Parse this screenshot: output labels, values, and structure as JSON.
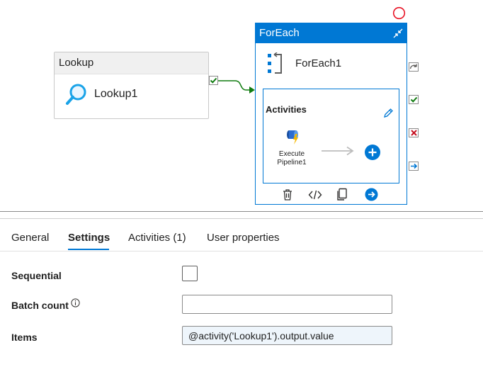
{
  "canvas": {
    "lookup": {
      "header": "Lookup",
      "name": "Lookup1"
    },
    "foreach": {
      "header": "ForEach",
      "name": "ForEach1",
      "activities_label": "Activities",
      "inner_activity": {
        "line1": "Execute",
        "line2": "Pipeline1"
      }
    }
  },
  "tabs": [
    {
      "label": "General"
    },
    {
      "label": "Settings"
    },
    {
      "label": "Activities (1)"
    },
    {
      "label": "User properties"
    }
  ],
  "settings": {
    "sequential_label": "Sequential",
    "sequential_checked": false,
    "batch_count_label": "Batch count",
    "batch_count_value": "",
    "items_label": "Items",
    "items_value": "@activity('Lookup1').output.value"
  },
  "colors": {
    "accent": "#0078d4",
    "success": "#107c10",
    "failure": "#c50f1f",
    "error_indicator": "#e81123"
  },
  "icons": {
    "lookup": "magnifier-icon",
    "foreach": "foreach-bracket-icon",
    "execute_pipeline": "execute-pipeline-icon",
    "edit": "pencil-icon",
    "add": "add-circle-icon",
    "delete": "trash-icon",
    "code": "code-icon",
    "copy": "copy-icon",
    "navigate": "arrow-circle-icon",
    "collapse": "collapse-icon",
    "info": "info-icon"
  }
}
